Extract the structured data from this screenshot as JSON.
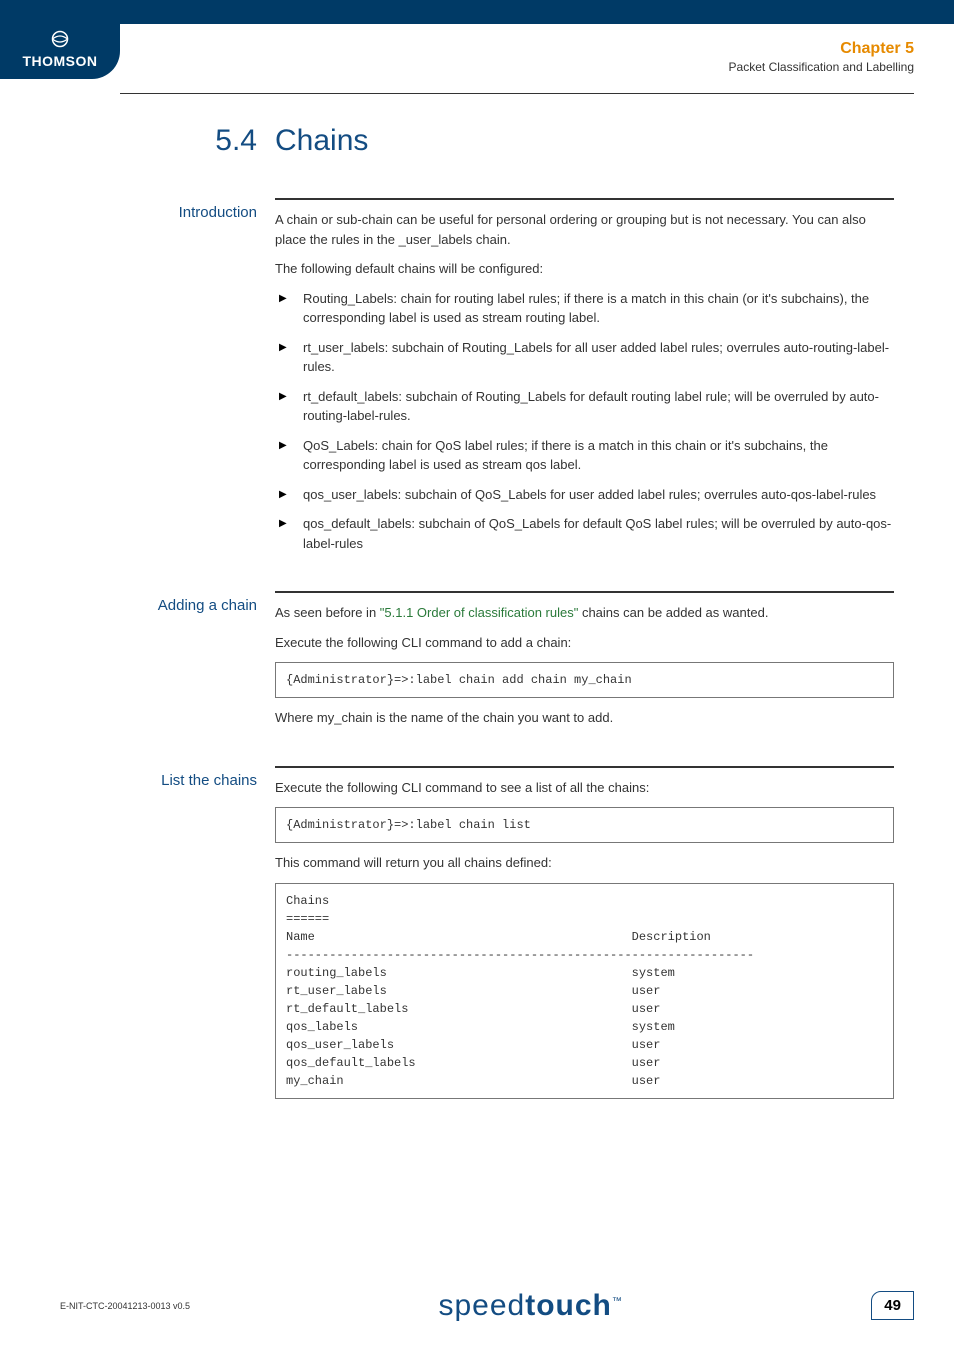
{
  "header": {
    "brand": "THOMSON",
    "chapter_label": "Chapter 5",
    "chapter_subtitle": "Packet Classification and Labelling"
  },
  "section": {
    "number": "5.4",
    "title": "Chains"
  },
  "intro": {
    "label": "Introduction",
    "p1": "A chain or sub-chain can be useful for personal ordering or grouping but is not necessary. You can also place the rules in the _user_labels chain.",
    "p2": "The following default chains will be configured:",
    "items": [
      "Routing_Labels: chain for routing label rules; if there is a match in this chain (or it's subchains), the corresponding label is used as stream routing label.",
      "rt_user_labels: subchain of Routing_Labels for all user added label rules; overrules auto-routing-label-rules.",
      "rt_default_labels: subchain of Routing_Labels for default routing label rule; will be overruled by auto-routing-label-rules.",
      "QoS_Labels: chain for QoS label rules; if there is a match in this chain or it's subchains, the corresponding label is used as stream qos label.",
      "qos_user_labels: subchain of QoS_Labels for user added label rules; overrules auto-qos-label-rules",
      "qos_default_labels: subchain of QoS_Labels for default QoS label rules; will be overruled by auto-qos-label-rules"
    ]
  },
  "adding": {
    "label": "Adding a chain",
    "p1_pre": "As seen before in ",
    "p1_link": "\"5.1.1 Order of classification rules\"",
    "p1_post": " chains can be added as wanted.",
    "p2": "Execute the following CLI command to add a chain:",
    "cli": "{Administrator}=>:label chain add chain my_chain",
    "p3": "Where my_chain is the name of the chain you want to add."
  },
  "list": {
    "label": "List the chains",
    "p1": "Execute the following CLI command to see a list of all the chains:",
    "cli": "{Administrator}=>:label chain list",
    "p2": "This command will return you all chains defined:",
    "output": "Chains\n======\nName                                            Description\n-----------------------------------------------------------------\nrouting_labels                                  system\nrt_user_labels                                  user\nrt_default_labels                               user\nqos_labels                                      system\nqos_user_labels                                 user\nqos_default_labels                              user\nmy_chain                                        user"
  },
  "footer": {
    "doc_id": "E-NIT-CTC-20041213-0013 v0.5",
    "brand_light": "speed",
    "brand_bold": "touch",
    "tm": "™",
    "page": "49"
  }
}
